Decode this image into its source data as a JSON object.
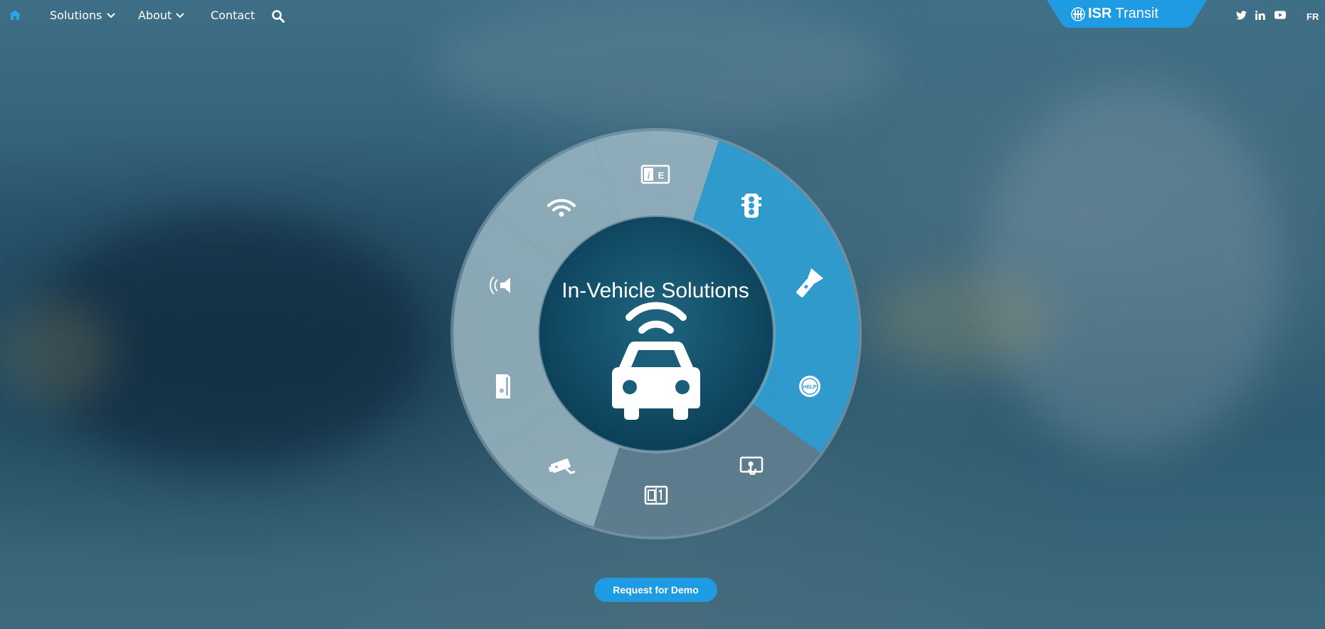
{
  "nav": {
    "home_icon": "home-icon",
    "items": [
      {
        "label": "Solutions",
        "has_dropdown": true
      },
      {
        "label": "About",
        "has_dropdown": true
      },
      {
        "label": "Contact",
        "has_dropdown": false
      }
    ],
    "search_icon": "search-icon"
  },
  "brand": {
    "bold": "ISR",
    "rest": " Transit",
    "color": "#1e9be3",
    "icon": "isr-logo-icon"
  },
  "social": [
    {
      "name": "twitter",
      "icon": "twitter-icon"
    },
    {
      "name": "linkedin",
      "icon": "linkedin-icon"
    },
    {
      "name": "youtube",
      "icon": "youtube-icon"
    }
  ],
  "lang_label": "FR",
  "wheel": {
    "title": "In-Vehicle Solutions",
    "center_icon": "connected-car-icon",
    "segments": [
      {
        "icon": "info-sign-icon",
        "state": "light"
      },
      {
        "icon": "traffic-light-icon",
        "state": "active"
      },
      {
        "icon": "flashlight-icon",
        "state": "active"
      },
      {
        "icon": "help-button-icon",
        "state": "active",
        "text": "HELP"
      },
      {
        "icon": "touch-screen-icon",
        "state": "dark"
      },
      {
        "icon": "counter-display-icon",
        "state": "dark"
      },
      {
        "icon": "security-camera-icon",
        "state": "light"
      },
      {
        "icon": "card-reader-icon",
        "state": "light"
      },
      {
        "icon": "speaker-icon",
        "state": "light"
      },
      {
        "icon": "wifi-icon",
        "state": "light"
      }
    ],
    "colors": {
      "active": "#2f9fd3",
      "light": "#9cb7c3",
      "dark": "#607f8f",
      "center": "#0f4a66"
    }
  },
  "cta": {
    "label": "Request for Demo",
    "color": "#1e9be3"
  }
}
